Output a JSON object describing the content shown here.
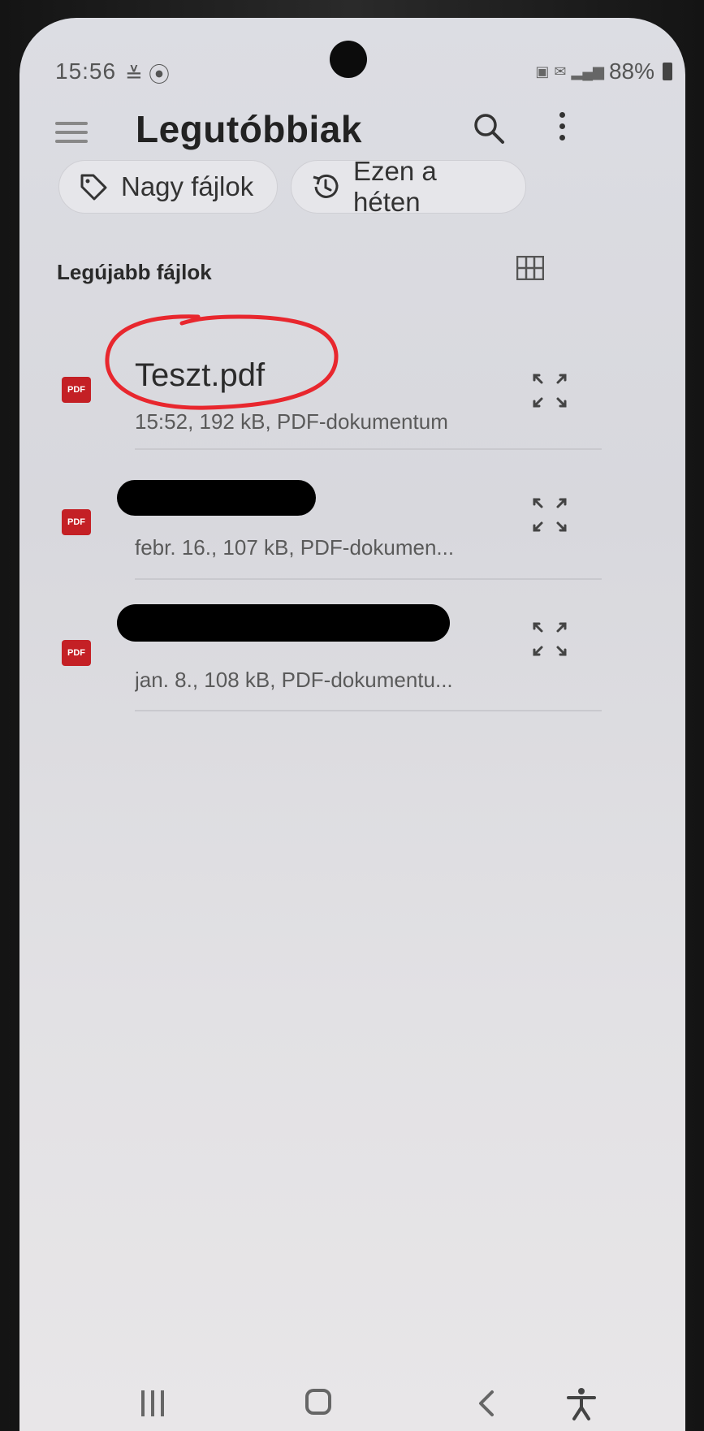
{
  "status_bar": {
    "time": "15:56",
    "notification_glyphs": "≚ ⦿",
    "battery": "88%"
  },
  "app_bar": {
    "title": "Legutóbbiak"
  },
  "chips": [
    {
      "label": "Nagy fájlok",
      "icon": "tag-icon"
    },
    {
      "label": "Ezen a héten",
      "icon": "history-icon"
    }
  ],
  "section": {
    "title": "Legújabb fájlok"
  },
  "files": [
    {
      "name": "Teszt.pdf",
      "meta": "15:52, 192 kB, PDF-dokumentum",
      "redacted": false,
      "highlighted": true
    },
    {
      "name": "",
      "meta": "febr. 16., 107 kB, PDF-dokumen...",
      "redacted": true,
      "highlighted": false
    },
    {
      "name": "",
      "meta": "jan. 8., 108 kB, PDF-dokumentu...",
      "redacted": true,
      "highlighted": false
    }
  ],
  "file_icon_label": "PDF",
  "colors": {
    "pdf_red": "#c42025",
    "highlight_red": "#e8272e"
  }
}
